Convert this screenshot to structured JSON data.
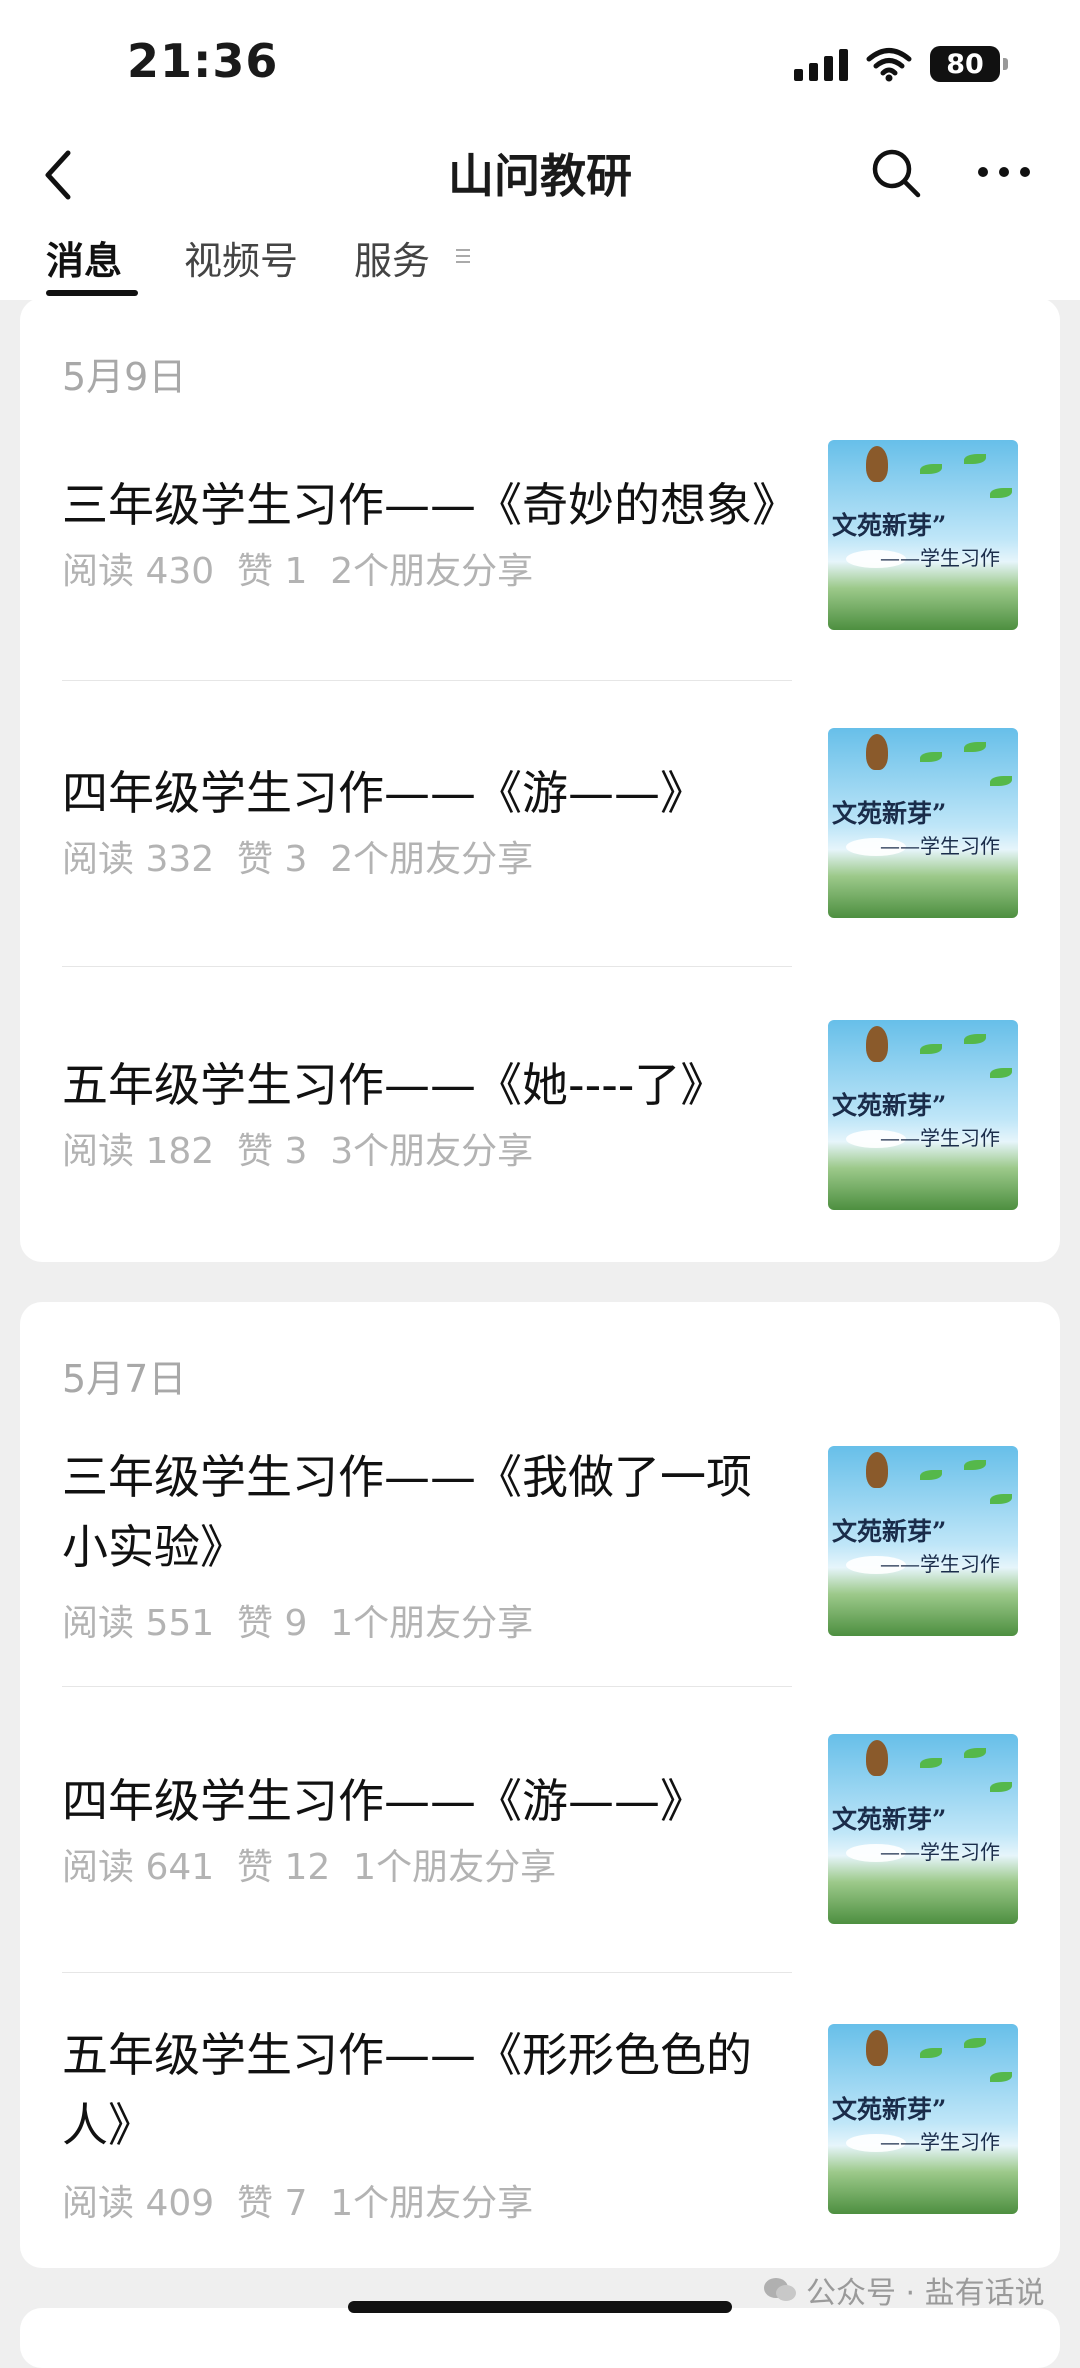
{
  "status_bar": {
    "time": "21:36",
    "battery": "80"
  },
  "nav": {
    "title": "山问教研"
  },
  "tabs": [
    {
      "label": "消息",
      "active": true
    },
    {
      "label": "视频号",
      "active": false
    },
    {
      "label": "服务",
      "active": false
    }
  ],
  "thumbnail": {
    "line1": "文苑新芽”",
    "line2": "——学生习作"
  },
  "groups": [
    {
      "date": "5月9日",
      "items": [
        {
          "title": "三年级学生习作——《奇妙的想象》",
          "meta": "阅读 430  赞 1  2个朋友分享"
        },
        {
          "title": "四年级学生习作——《游——》",
          "meta": "阅读 332  赞 3  2个朋友分享"
        },
        {
          "title": "五年级学生习作——《她----了》",
          "meta": "阅读 182  赞 3  3个朋友分享"
        }
      ]
    },
    {
      "date": "5月7日",
      "items": [
        {
          "title": "三年级学生习作——《我做了一项小实验》",
          "meta": "阅读 551  赞 9  1个朋友分享"
        },
        {
          "title": "四年级学生习作——《游——》",
          "meta": "阅读 641  赞 12  1个朋友分享"
        },
        {
          "title": "五年级学生习作——《形形色色的人》",
          "meta": "阅读 409  赞 7  1个朋友分享"
        }
      ]
    }
  ],
  "watermark": "公众号 · 盐有话说"
}
